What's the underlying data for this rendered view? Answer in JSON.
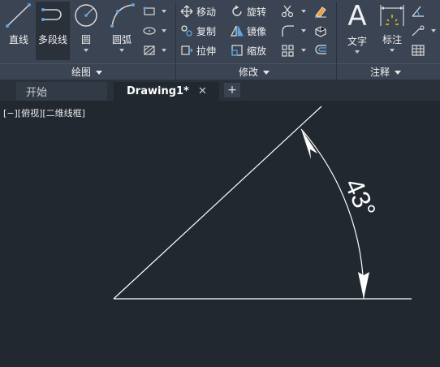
{
  "ribbon": {
    "draw_panel": {
      "label": "绘图",
      "tools": [
        {
          "name": "line",
          "label": "直线"
        },
        {
          "name": "polyline",
          "label": "多段线"
        },
        {
          "name": "circle",
          "label": "圆"
        },
        {
          "name": "arc",
          "label": "圆弧"
        }
      ]
    },
    "modify_panel": {
      "label": "修改",
      "tools": [
        {
          "name": "move",
          "label": "移动"
        },
        {
          "name": "rotate",
          "label": "旋转"
        },
        {
          "name": "copy",
          "label": "复制"
        },
        {
          "name": "mirror",
          "label": "镜像"
        },
        {
          "name": "stretch",
          "label": "拉伸"
        },
        {
          "name": "scale",
          "label": "缩放"
        }
      ]
    },
    "annotation_panel": {
      "label": "注释",
      "tools": [
        {
          "name": "text",
          "label": "文字",
          "glyph": "A"
        },
        {
          "name": "dimension",
          "label": "标注"
        }
      ]
    }
  },
  "tabs": [
    {
      "label": "开始",
      "active": false
    },
    {
      "label": "Drawing1*",
      "active": true,
      "close": "✕"
    }
  ],
  "tab_add_label": "+",
  "viewport_label": "[−][俯视][二维线框]",
  "drawing": {
    "angle_dimension_text": "43°",
    "angle_degrees": 43
  },
  "colors": {
    "ribbon_bg": "#3b4453",
    "canvas_bg": "#212830",
    "line": "#ffffff",
    "icon_blue": "#5aa6e6"
  }
}
